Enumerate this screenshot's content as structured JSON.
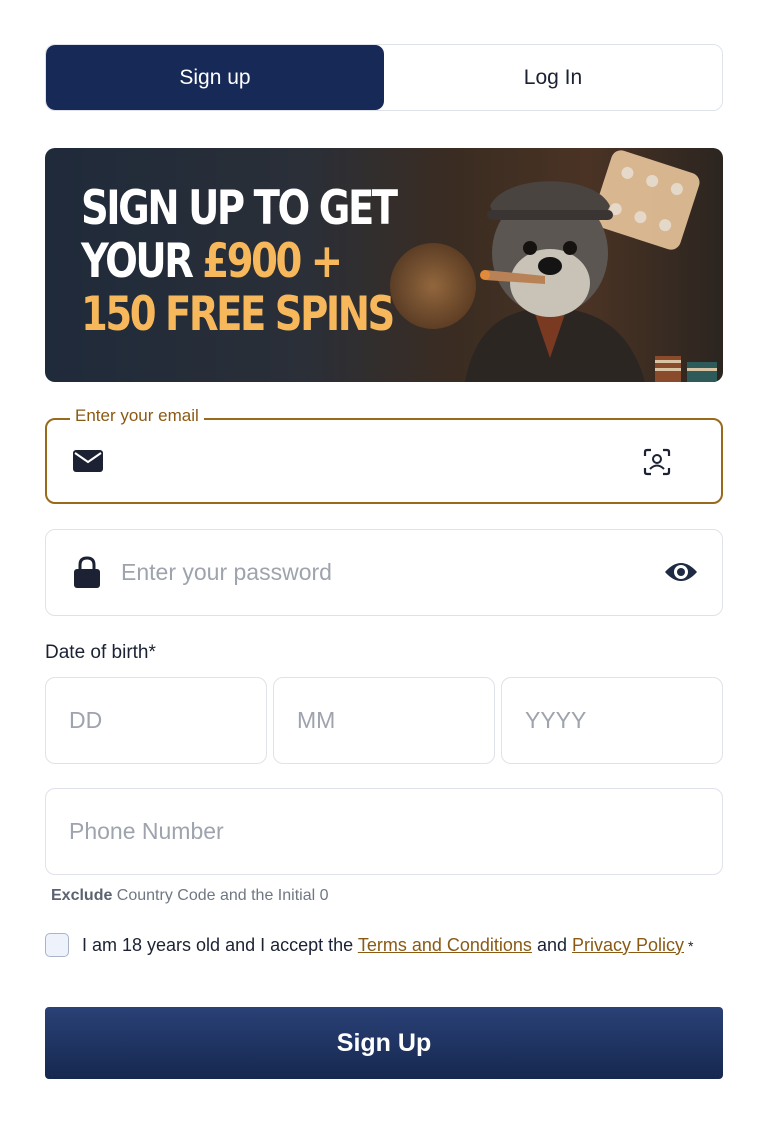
{
  "tabs": {
    "signup_label": "Sign up",
    "login_label": "Log In"
  },
  "banner": {
    "line1": "SIGN UP TO GET",
    "line2_white": "YOUR ",
    "line2_gold": "£900 +",
    "line3": "150 FREE SPINS"
  },
  "form": {
    "email_legend": "Enter your email",
    "email_value": "",
    "password_placeholder": "Enter your password",
    "dob_label": "Date of birth*",
    "dd_placeholder": "DD",
    "mm_placeholder": "MM",
    "yyyy_placeholder": "YYYY",
    "phone_placeholder": "Phone Number",
    "hint_bold": "Exclude",
    "hint_rest": " Country Code and the Initial 0",
    "consent_prefix": "I am 18 years old and I accept the ",
    "terms_link": "Terms and Conditions",
    "consent_and": " and ",
    "privacy_link": "Privacy Policy",
    "required_mark": "*",
    "submit_label": "Sign Up"
  },
  "icons": {
    "email": "envelope-icon",
    "email_action": "face-scan-icon",
    "password": "lock-icon",
    "password_toggle": "eye-icon"
  },
  "colors": {
    "primary": "#172956",
    "accent": "#9a6a1c",
    "banner_gold": "#f7b85c"
  }
}
